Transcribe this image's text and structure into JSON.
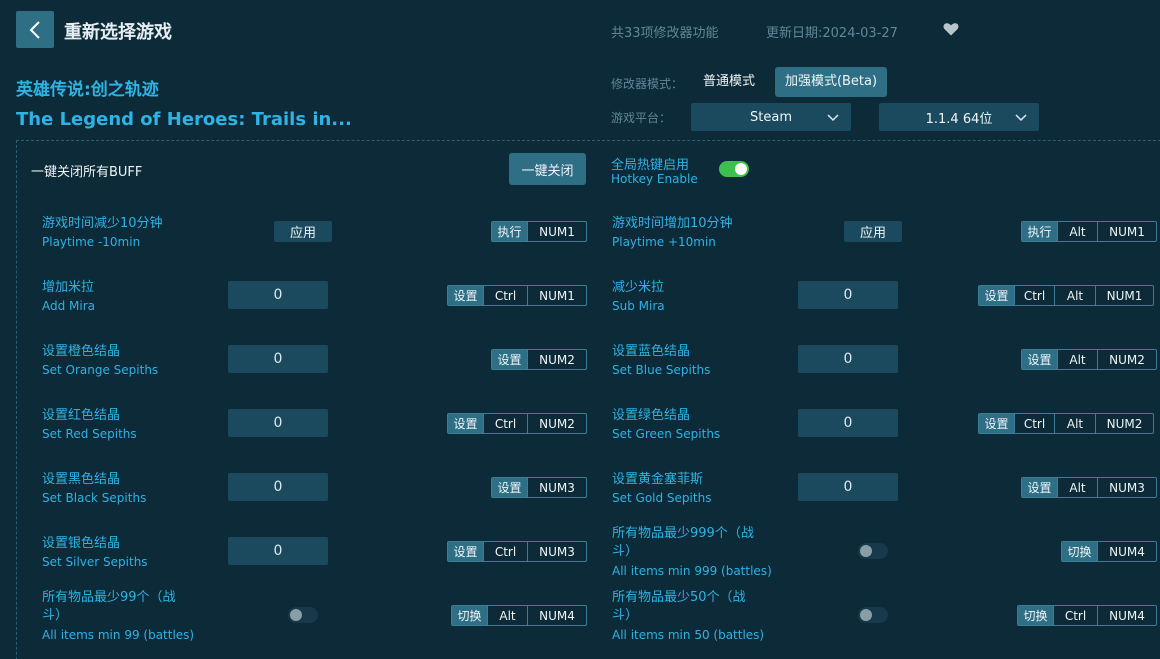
{
  "header": {
    "back_icon": "chevron-left-icon",
    "title": "重新选择游戏",
    "feature_count": "共33项修改器功能",
    "update_date": "更新日期:2024-03-27",
    "favorite_icon": "heart-icon"
  },
  "game": {
    "name_cn": "英雄传说:创之轨迹",
    "name_en": "The Legend of Heroes: Trails in..."
  },
  "mode": {
    "label": "修改器模式：",
    "normal": "普通模式",
    "enhanced": "加强模式(Beta)",
    "selected": "加强模式(Beta)"
  },
  "platform": {
    "label": "游戏平台：",
    "value": "Steam",
    "version": "1.1.4 64位"
  },
  "global": {
    "close_all_label": "一键关闭所有BUFF",
    "close_all_button": "一键关闭",
    "hotkey_cn": "全局热键启用",
    "hotkey_en": "Hotkey Enable",
    "hotkey_enabled": true
  },
  "colors": {
    "background": "#0d2a38",
    "accent": "#2e6f86",
    "label_blue": "#2fb2e4",
    "toggle_on": "#3fbf4f"
  },
  "features": [
    {
      "cn": "游戏时间减少10分钟",
      "en": "Playtime -10min",
      "control": "应用",
      "keys": [
        "执行",
        "NUM1"
      ]
    },
    {
      "cn": "游戏时间增加10分钟",
      "en": "Playtime +10min",
      "control": "应用",
      "keys": [
        "执行",
        "Alt",
        "NUM1"
      ]
    },
    {
      "cn": "增加米拉",
      "en": "Add Mira",
      "control": "0",
      "keys": [
        "设置",
        "Ctrl",
        "NUM1"
      ]
    },
    {
      "cn": "减少米拉",
      "en": "Sub Mira",
      "control": "0",
      "keys": [
        "设置",
        "Ctrl",
        "Alt",
        "NUM1"
      ]
    },
    {
      "cn": "设置橙色结晶",
      "en": "Set Orange Sepiths",
      "control": "0",
      "keys": [
        "设置",
        "NUM2"
      ]
    },
    {
      "cn": "设置蓝色结晶",
      "en": "Set Blue Sepiths",
      "control": "0",
      "keys": [
        "设置",
        "Alt",
        "NUM2"
      ]
    },
    {
      "cn": "设置红色结晶",
      "en": "Set Red Sepiths",
      "control": "0",
      "keys": [
        "设置",
        "Ctrl",
        "NUM2"
      ]
    },
    {
      "cn": "设置绿色结晶",
      "en": "Set Green Sepiths",
      "control": "0",
      "keys": [
        "设置",
        "Ctrl",
        "Alt",
        "NUM2"
      ]
    },
    {
      "cn": "设置黑色结晶",
      "en": "Set Black Sepiths",
      "control": "0",
      "keys": [
        "设置",
        "NUM3"
      ]
    },
    {
      "cn": "设置黄金塞菲斯",
      "en": "Set Gold Sepiths",
      "control": "0",
      "keys": [
        "设置",
        "Alt",
        "NUM3"
      ]
    },
    {
      "cn": "设置银色结晶",
      "en": "Set Silver Sepiths",
      "control": "0",
      "keys": [
        "设置",
        "Ctrl",
        "NUM3"
      ]
    },
    {
      "cn_1": "所有物品最少999个（战",
      "cn_2": "斗）",
      "en": "All items min 999 (battles)",
      "enabled": false,
      "keys": [
        "切换",
        "NUM4"
      ]
    },
    {
      "cn_1": "所有物品最少99个（战",
      "cn_2": "斗）",
      "en": "All items min 99 (battles)",
      "enabled": false,
      "keys": [
        "切换",
        "Alt",
        "NUM4"
      ]
    },
    {
      "cn_1": "所有物品最少50个（战",
      "cn_2": "斗）",
      "en": "All items min 50 (battles)",
      "enabled": false,
      "keys": [
        "切换",
        "Ctrl",
        "NUM4"
      ]
    }
  ]
}
